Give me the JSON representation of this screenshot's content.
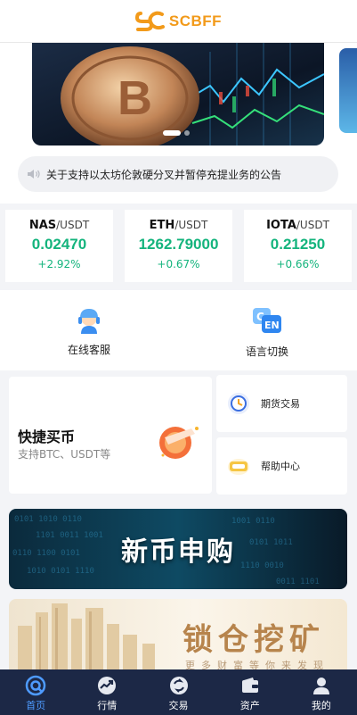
{
  "header": {
    "brand": "SCBFF"
  },
  "notice": {
    "text": "关于支持以太坊伦敦硬分叉并暂停充提业务的公告"
  },
  "tickers": [
    {
      "base": "NAS",
      "quote": "/USDT",
      "price": "0.02470",
      "change": "+2.92%"
    },
    {
      "base": "ETH",
      "quote": "/USDT",
      "price": "1262.79000",
      "change": "+0.67%"
    },
    {
      "base": "IOTA",
      "quote": "/USDT",
      "price": "0.21250",
      "change": "+0.66%"
    }
  ],
  "services": {
    "support": {
      "label": "在线客服",
      "icon": "headset-agent-icon"
    },
    "language": {
      "label": "语言切换",
      "icon": "language-cn-en-icon"
    }
  },
  "quick_buy": {
    "title": "快捷买币",
    "subtitle": "支持BTC、USDT等"
  },
  "side_cards": {
    "futures": {
      "label": "期货交易"
    },
    "help": {
      "label": "帮助中心"
    }
  },
  "promos": {
    "new_coin": {
      "title": "新币申购"
    },
    "lock_mining": {
      "title": "锁仓挖矿",
      "subtitle": "更多财富等你来发现"
    }
  },
  "tabs": [
    {
      "label": "首页",
      "icon": "home-icon",
      "active": true
    },
    {
      "label": "行情",
      "icon": "market-icon"
    },
    {
      "label": "交易",
      "icon": "trade-icon"
    },
    {
      "label": "资产",
      "icon": "wallet-icon"
    },
    {
      "label": "我的",
      "icon": "user-icon"
    }
  ],
  "colors": {
    "brand": "#f29a1a",
    "up": "#14b47d",
    "tabbar": "#1c2846",
    "tab_active": "#4e9bff"
  }
}
